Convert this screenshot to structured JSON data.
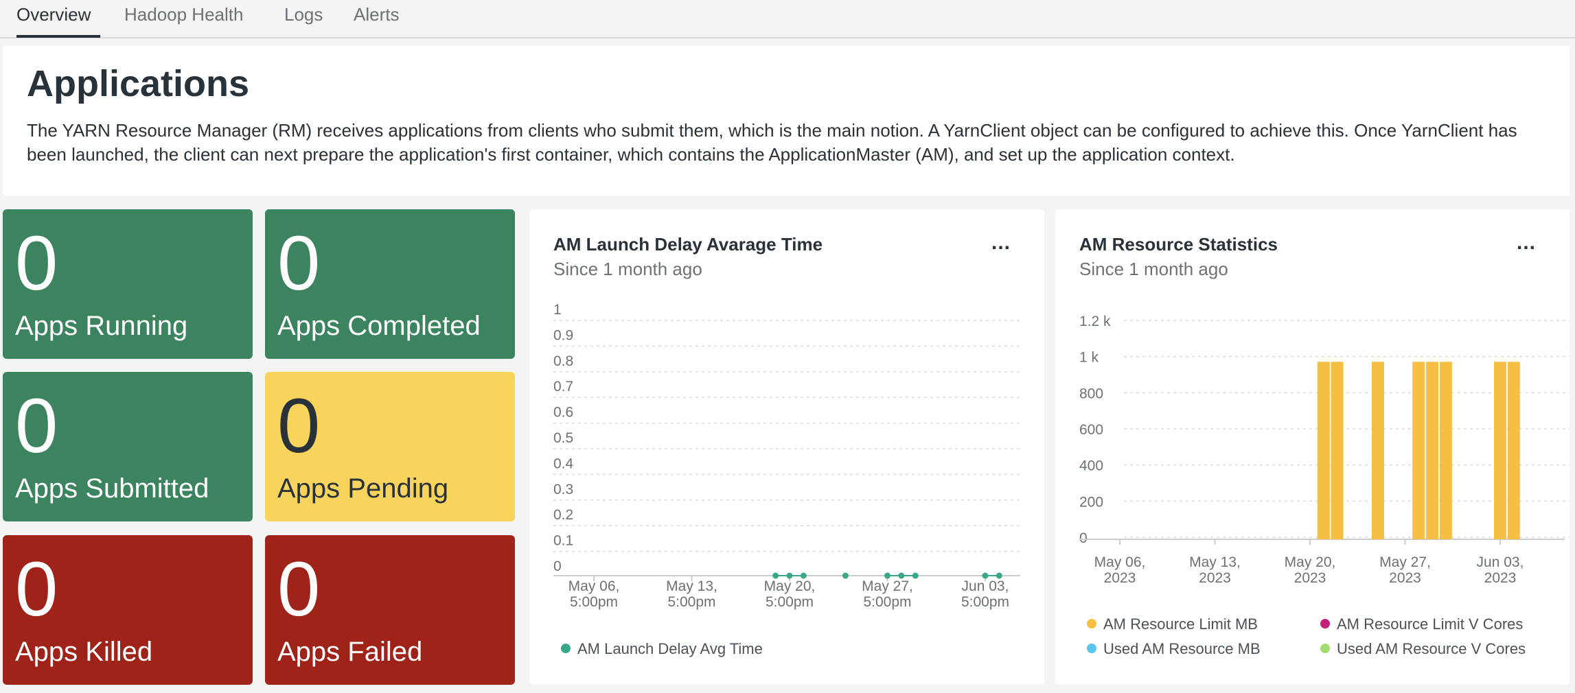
{
  "tabs": [
    {
      "label": "Overview",
      "active": true
    },
    {
      "label": "Hadoop Health",
      "active": false
    },
    {
      "label": "Logs",
      "active": false
    },
    {
      "label": "Alerts",
      "active": false
    }
  ],
  "intro": {
    "title": "Applications",
    "text": "The YARN Resource Manager (RM) receives applications from clients who submit them, which is the main notion. A YarnClient object can be configured to achieve this. Once YarnClient has been launched, the client can next prepare the application's first container, which contains the ApplicationMaster (AM), and set up the application context."
  },
  "tiles": [
    {
      "value": "0",
      "label": "Apps Running",
      "color": "#3b845f"
    },
    {
      "value": "0",
      "label": "Apps Completed",
      "color": "#3b845f"
    },
    {
      "value": "0",
      "label": "Apps Submitted",
      "color": "#3b845f"
    },
    {
      "value": "0",
      "label": "Apps Pending",
      "color": "#f9d45c"
    },
    {
      "value": "0",
      "label": "Apps Killed",
      "color": "#a0231a"
    },
    {
      "value": "0",
      "label": "Apps Failed",
      "color": "#a0231a"
    }
  ],
  "more_label": "...",
  "chart_data": [
    {
      "type": "line",
      "title": "AM Launch Delay Avarage Time",
      "subtitle": "Since 1 month ago",
      "y_ticks": [
        "0",
        "0.1",
        "0.2",
        "0.3",
        "0.4",
        "0.5",
        "0.6",
        "0.7",
        "0.8",
        "0.9",
        "1"
      ],
      "ylim": [
        0,
        1
      ],
      "x_ticks": [
        {
          "line1": "May 06,",
          "line2": "5:00pm"
        },
        {
          "line1": "May 13,",
          "line2": "5:00pm"
        },
        {
          "line1": "May 20,",
          "line2": "5:00pm"
        },
        {
          "line1": "May 27,",
          "line2": "5:00pm"
        },
        {
          "line1": "Jun 03,",
          "line2": "5:00pm"
        }
      ],
      "grid": true,
      "series": [
        {
          "name": "AM Launch Delay Avg Time",
          "color": "#3aa78a",
          "x": [
            "May 19",
            "May 20",
            "May 21",
            "May 24",
            "May 27",
            "May 28",
            "May 29",
            "Jun 03",
            "Jun 04"
          ],
          "y": [
            0,
            0,
            0,
            0,
            0,
            0,
            0,
            0,
            0
          ]
        }
      ],
      "legend_position": "bottom-left"
    },
    {
      "type": "bar",
      "title": "AM Resource Statistics",
      "subtitle": "Since 1 month ago",
      "y_ticks": [
        "0",
        "200",
        "400",
        "600",
        "800",
        "1 k",
        "1.2 k"
      ],
      "ylim": [
        0,
        1200
      ],
      "x_ticks": [
        {
          "line1": "May 06,",
          "line2": "2023"
        },
        {
          "line1": "May 13,",
          "line2": "2023"
        },
        {
          "line1": "May 20,",
          "line2": "2023"
        },
        {
          "line1": "May 27,",
          "line2": "2023"
        },
        {
          "line1": "Jun 03,",
          "line2": "2023"
        }
      ],
      "grid": true,
      "categories": [
        "May 21",
        "May 22",
        "May 25",
        "May 28",
        "May 29",
        "May 30",
        "Jun 03",
        "Jun 04"
      ],
      "series": [
        {
          "name": "AM Resource Limit MB",
          "color": "#f4bf42",
          "values": [
            1024,
            1024,
            1024,
            1024,
            1024,
            1024,
            1024,
            1024
          ]
        },
        {
          "name": "AM Resource Limit V Cores",
          "color": "#c3207d",
          "values": [
            0,
            0,
            0,
            0,
            0,
            0,
            0,
            0
          ]
        },
        {
          "name": "Used AM Resource MB",
          "color": "#5bc4ec",
          "values": [
            0,
            0,
            0,
            0,
            0,
            0,
            0,
            0
          ]
        },
        {
          "name": "Used AM Resource V Cores",
          "color": "#a3dc70",
          "values": [
            0,
            0,
            0,
            0,
            0,
            0,
            0,
            0
          ]
        }
      ],
      "legend_position": "bottom"
    }
  ]
}
